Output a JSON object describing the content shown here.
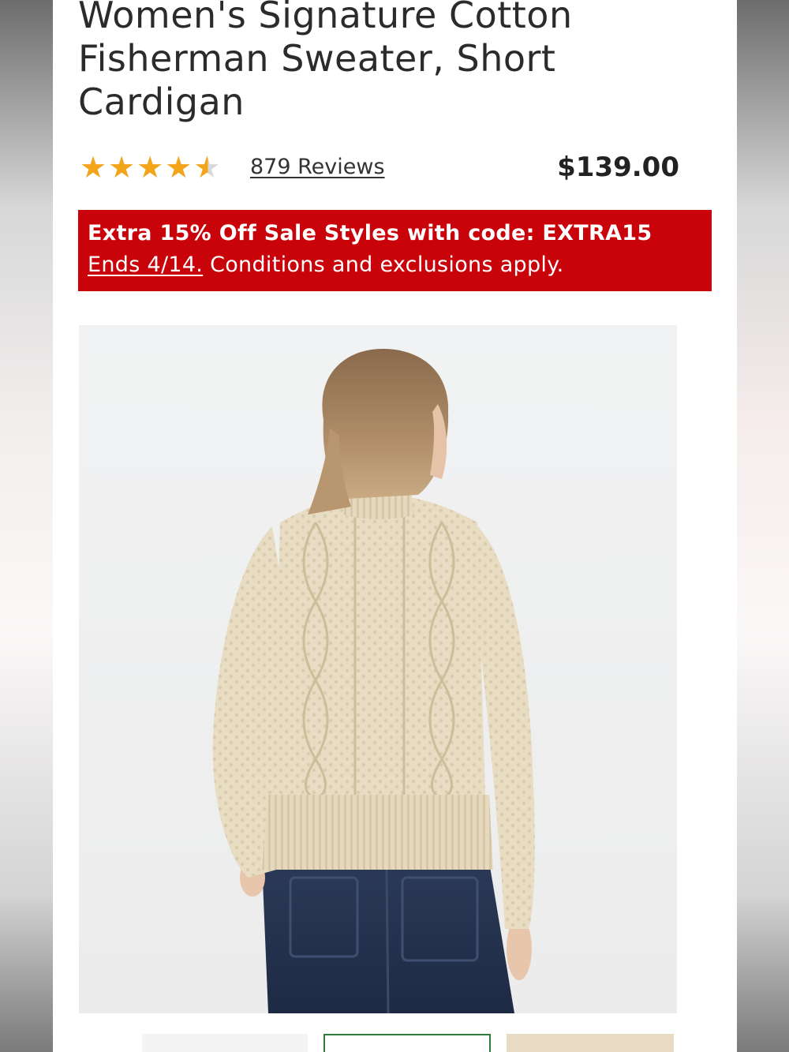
{
  "product": {
    "title": "Women's Signature Cotton Fisherman Sweater, Short Cardigan",
    "rating": 4.5,
    "reviews_label": "879 Reviews",
    "price": "$139.00"
  },
  "promo": {
    "headline": "Extra 15% Off Sale Styles with code: EXTRA15",
    "ends_link": "Ends 4/14.",
    "conditions": " Conditions and exclusions apply."
  },
  "colors": {
    "promo_bg": "#c8030a",
    "star": "#f2a41b",
    "selected_thumb_border": "#2f7a3a"
  }
}
